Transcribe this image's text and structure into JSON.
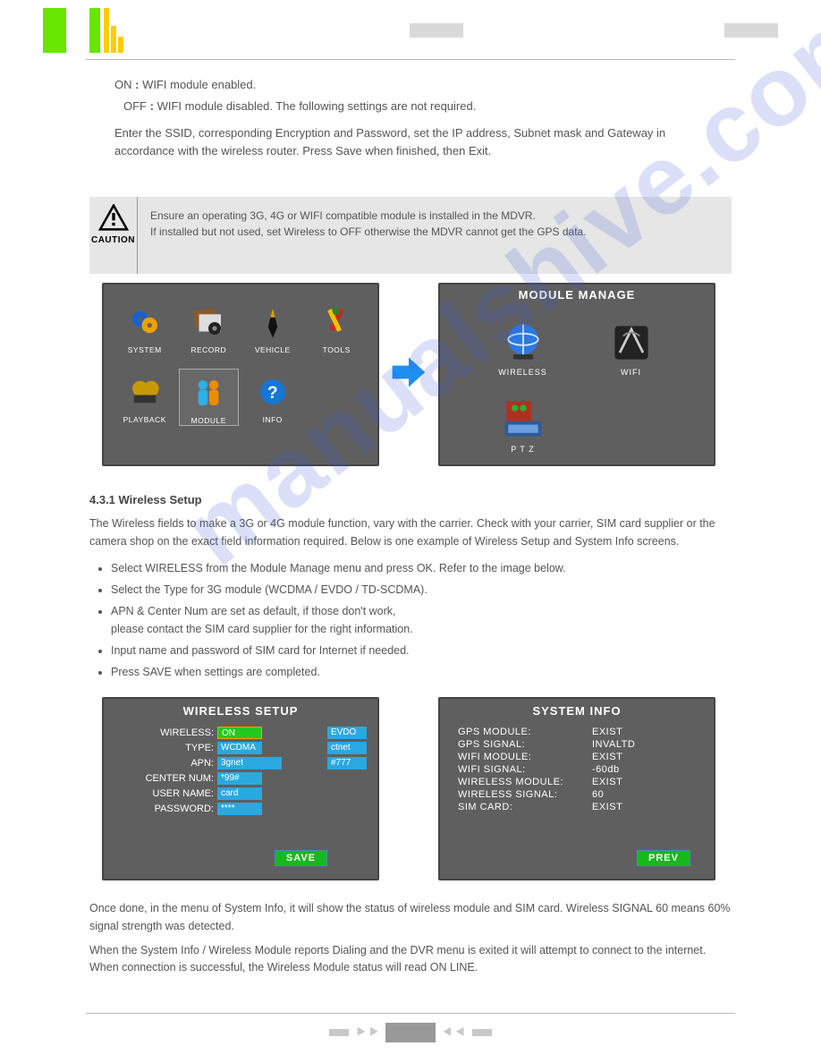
{
  "doc_text": {
    "line1_label": "ON",
    "line1_colon": ":",
    "line1_val": "WIFI module enabled.",
    "line2_label": "OFF",
    "line2_colon": ":",
    "line2_val": "WIFI module disabled. The following settings are not required.",
    "para": "Enter the SSID, corresponding Encryption and Password, set the IP address, Subnet mask and Gateway in accordance with the wireless router. Press Save when finished, then Exit."
  },
  "caution": {
    "icon_label": "CAUTION",
    "msg1": "Ensure an operating 3G, 4G or WIFI compatible module is installed in the MDVR.",
    "msg2": "If installed but not used, set Wireless to OFF otherwise the MDVR cannot get the GPS data."
  },
  "main_menu": {
    "items": [
      "SYSTEM",
      "RECORD",
      "VEHICLE",
      "TOOLS",
      "PLAYBACK",
      "MODULE",
      "INFO"
    ],
    "selected_index": 5
  },
  "module_manage": {
    "title": "MODULE  MANAGE",
    "items": [
      "WIRELESS",
      "WIFI",
      "P T Z"
    ]
  },
  "mid": {
    "heading": "4.3.1 Wireless Setup",
    "para": "The Wireless fields to make a 3G or 4G module function, vary with the carrier. Check with your carrier, SIM card supplier or the camera shop on the exact field information required. Below is one example of Wireless Setup and System Info screens.",
    "bullet1": "Select WIRELESS from the Module Manage menu and press OK. Refer to the image below.",
    "bullet2": "Select the Type for 3G module (WCDMA / EVDO / TD-SCDMA).",
    "bullet3": "APN & Center Num are set as default, if those don't work,",
    "bullet3b": "please contact the SIM card supplier for the right information.",
    "bullet4": "Input name and password of SIM card for Internet if needed.",
    "bullet5": "Press SAVE when settings are completed."
  },
  "wireless_setup": {
    "title": "WIRELESS  SETUP",
    "rows": {
      "wireless": {
        "label": "WIRELESS:",
        "value": "ON",
        "ext": "EVDO"
      },
      "type": {
        "label": "TYPE:",
        "value": "WCDMA",
        "ext": "ctnet"
      },
      "apn": {
        "label": "APN:",
        "value": "3gnet",
        "ext": "#777"
      },
      "center": {
        "label": "CENTER NUM:",
        "value": "*99#"
      },
      "user": {
        "label": "USER NAME:",
        "value": "card"
      },
      "pass": {
        "label": "PASSWORD:",
        "value": "****"
      }
    },
    "save": "SAVE"
  },
  "system_info": {
    "title": "SYSTEM  INFO",
    "rows": [
      {
        "label": "GPS MODULE:",
        "value": "EXIST"
      },
      {
        "label": "GPS SIGNAL:",
        "value": "INVALTD"
      },
      {
        "label": "WIFI MODULE:",
        "value": "EXIST"
      },
      {
        "label": "WIFI  SIGNAL:",
        "value": "-60db"
      },
      {
        "label": "WIRELESS MODULE:",
        "value": "EXIST"
      },
      {
        "label": "WIRELESS SIGNAL:",
        "value": "60"
      },
      {
        "label": "SIM CARD:",
        "value": "EXIST"
      }
    ],
    "prev": "PREV"
  },
  "end": {
    "para1": "Once done, in the menu of System Info, it will show the status of wireless module and SIM card. Wireless SIGNAL 60 means 60% signal strength was detected.",
    "para2": "When the System Info / Wireless Module reports Dialing and the DVR menu is exited it will attempt to connect to the internet. When connection is successful, the Wireless Module status will read ON LINE."
  },
  "watermark": "manualshive.com"
}
